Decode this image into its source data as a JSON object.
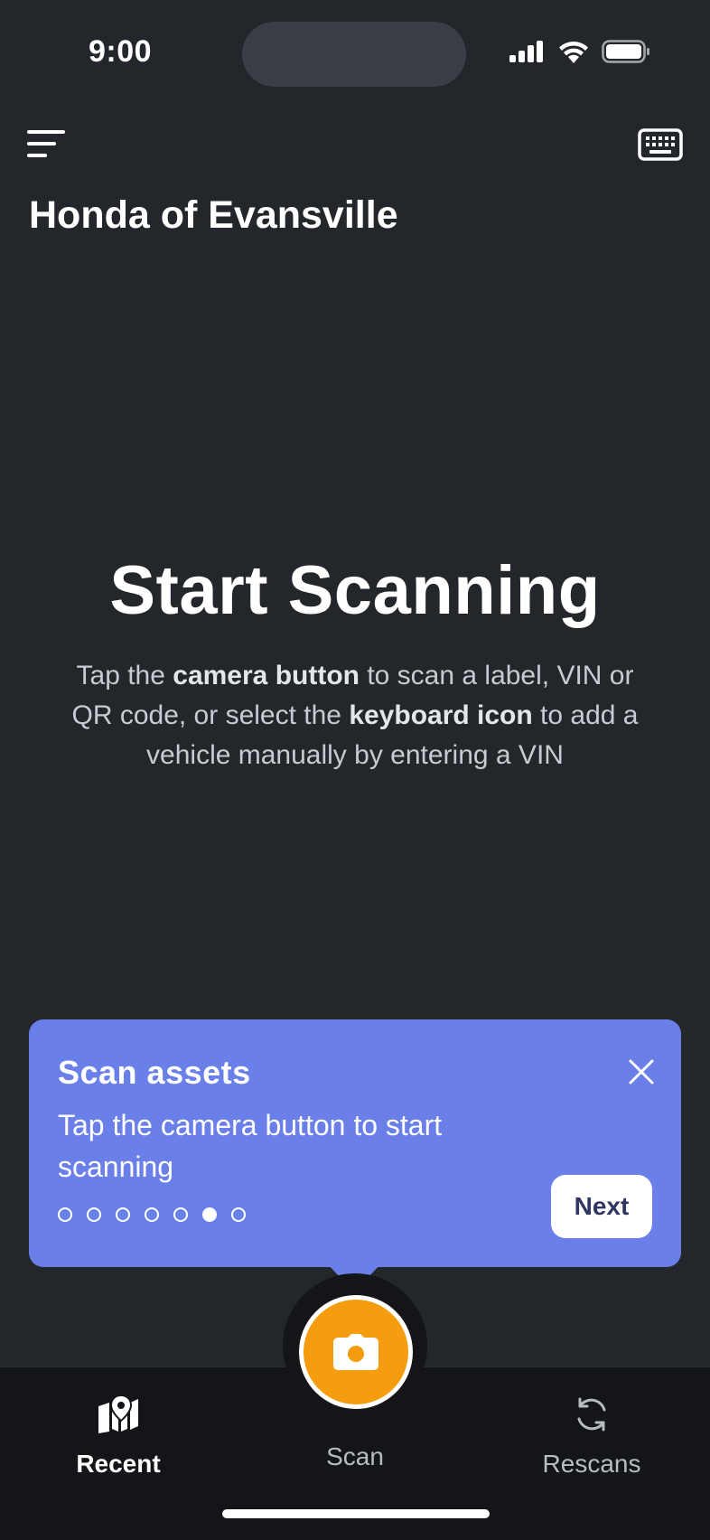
{
  "status_bar": {
    "time": "9:00"
  },
  "header": {
    "menu_icon": "menu-icon",
    "keyboard_icon": "keyboard-icon",
    "dealer_name": "Honda of Evansville"
  },
  "hero": {
    "title": "Start Scanning",
    "desc_part1": "Tap the ",
    "desc_bold1": "camera button",
    "desc_part2": " to scan a label, VIN or QR code, or select the ",
    "desc_bold2": "keyboard icon",
    "desc_part3": " to add a vehicle manually by entering  a VIN"
  },
  "tooltip": {
    "title": "Scan assets",
    "body": "Tap the camera button to start scanning",
    "next_label": "Next",
    "steps_total": 7,
    "active_step": 6,
    "color": "#6a7fe8"
  },
  "tabbar": {
    "tabs": [
      {
        "label": "Recent",
        "icon": "map-icon",
        "active": true
      },
      {
        "label": "Scan",
        "icon": "camera-icon",
        "active": false
      },
      {
        "label": "Rescans",
        "icon": "refresh-icon",
        "active": false
      }
    ],
    "camera_color": "#f59d0e"
  }
}
